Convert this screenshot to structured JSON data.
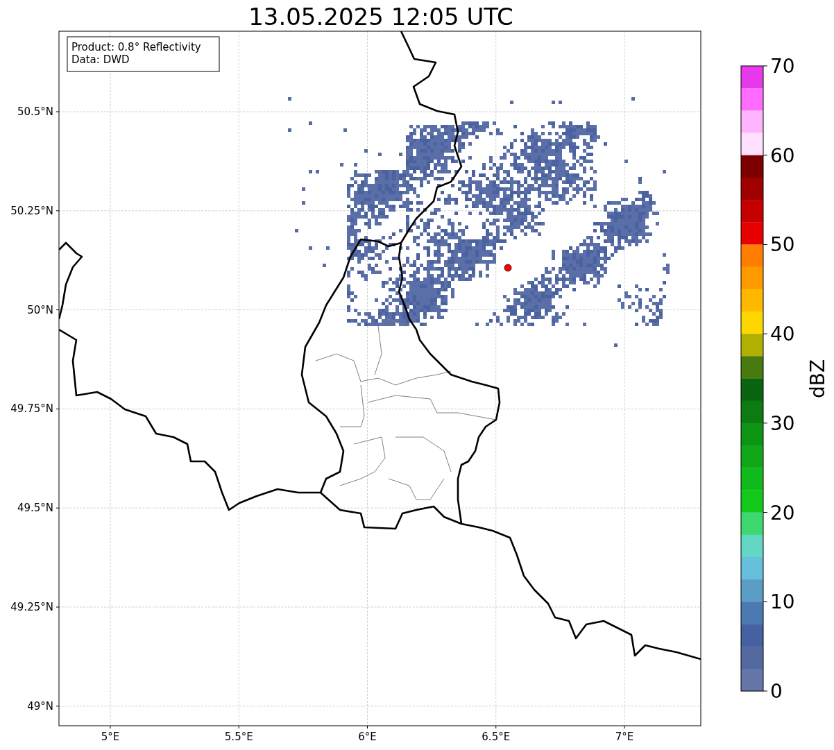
{
  "title": "13.05.2025 12:05 UTC",
  "info_box": [
    "Product: 0.8° Reflectivity",
    "Data: DWD"
  ],
  "map": {
    "lat_labels": [
      "50.5°N",
      "50.25°N",
      "50°N",
      "49.75°N",
      "49.5°N",
      "49.25°N",
      "49°N"
    ],
    "lon_labels": [
      "5°E",
      "5.5°E",
      "6°E",
      "6.5°E",
      "7°E"
    ]
  },
  "colorbar": {
    "label": "dBZ",
    "ticks": [
      "70",
      "60",
      "50",
      "40",
      "30",
      "20",
      "10",
      "0"
    ],
    "bins": [
      {
        "color": "#e83aec"
      },
      {
        "color": "#ff6cff"
      },
      {
        "color": "#ffb4ff"
      },
      {
        "color": "#ffe0ff"
      },
      {
        "color": "#7c0000"
      },
      {
        "color": "#a00000"
      },
      {
        "color": "#c40000"
      },
      {
        "color": "#e60000"
      },
      {
        "color": "#ff7d00"
      },
      {
        "color": "#ff9900"
      },
      {
        "color": "#ffb800"
      },
      {
        "color": "#ffd700"
      },
      {
        "color": "#b2b000"
      },
      {
        "color": "#497a10"
      },
      {
        "color": "#0a6410"
      },
      {
        "color": "#0c7c12"
      },
      {
        "color": "#0e9415"
      },
      {
        "color": "#10a818"
      },
      {
        "color": "#10b91c"
      },
      {
        "color": "#12c91a"
      },
      {
        "color": "#3dd870"
      },
      {
        "color": "#63d7c4"
      },
      {
        "color": "#66c0dc"
      },
      {
        "color": "#5b9dc6"
      },
      {
        "color": "#4b79b2"
      },
      {
        "color": "#4561a1"
      },
      {
        "color": "#536aa0"
      },
      {
        "color": "#6577a8"
      }
    ]
  }
}
